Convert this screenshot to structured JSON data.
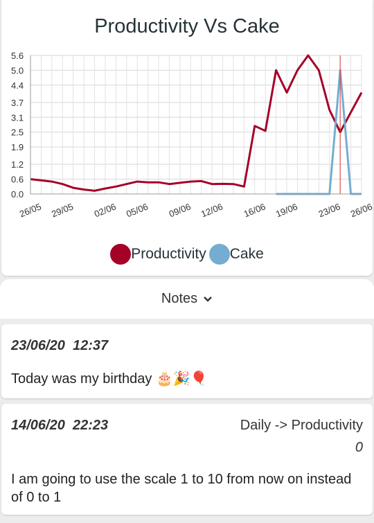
{
  "chart_data": {
    "type": "line",
    "title": "Productivity Vs Cake",
    "y_ticks": [
      "0.0",
      "0.6",
      "1.2",
      "1.9",
      "2.5",
      "3.1",
      "3.7",
      "4.4",
      "5.0",
      "5.6"
    ],
    "x_ticks": [
      "26/05",
      "29/05",
      "02/06",
      "05/06",
      "09/06",
      "12/06",
      "16/06",
      "19/06",
      "23/06",
      "26/06"
    ],
    "x_tick_days": [
      0,
      3,
      7,
      10,
      14,
      17,
      21,
      24,
      28,
      31
    ],
    "ylim": [
      0,
      5.6
    ],
    "x_range_days": [
      0,
      31
    ],
    "grid": true,
    "legend_position": "bottom",
    "marker_day": 29,
    "series": [
      {
        "name": "Productivity",
        "color": "#a50026",
        "points": [
          [
            0,
            0.6
          ],
          [
            1,
            0.55
          ],
          [
            2,
            0.5
          ],
          [
            3,
            0.4
          ],
          [
            4,
            0.25
          ],
          [
            5,
            0.18
          ],
          [
            6,
            0.13
          ],
          [
            7,
            0.22
          ],
          [
            8,
            0.3
          ],
          [
            9,
            0.4
          ],
          [
            10,
            0.5
          ],
          [
            11,
            0.47
          ],
          [
            12,
            0.47
          ],
          [
            13,
            0.4
          ],
          [
            14,
            0.45
          ],
          [
            15,
            0.5
          ],
          [
            16,
            0.52
          ],
          [
            17,
            0.4
          ],
          [
            18,
            0.41
          ],
          [
            19,
            0.4
          ],
          [
            20,
            0.3
          ],
          [
            21,
            2.75
          ],
          [
            22,
            2.55
          ],
          [
            23,
            5.0
          ],
          [
            24,
            4.1
          ],
          [
            25,
            5.0
          ],
          [
            26,
            5.6
          ],
          [
            27,
            5.0
          ],
          [
            28,
            3.4
          ],
          [
            29,
            2.5
          ],
          [
            30,
            3.3
          ],
          [
            31,
            4.1
          ]
        ]
      },
      {
        "name": "Cake",
        "color": "#74add1",
        "points": [
          [
            23,
            0
          ],
          [
            24,
            0
          ],
          [
            25,
            0
          ],
          [
            26,
            0
          ],
          [
            27,
            0
          ],
          [
            28,
            0
          ],
          [
            29,
            5.0
          ],
          [
            30,
            0
          ],
          [
            31,
            0
          ]
        ]
      }
    ]
  },
  "notes_header": {
    "label": "Notes"
  },
  "notes": [
    {
      "date": "23/06/20  12:37",
      "text": "Today was my birthday 🎂🎉🎈"
    },
    {
      "date": "14/06/20  22:23",
      "tracker": "Daily -> Productivity",
      "value": "0",
      "text": "I am going to use the scale 1 to 10 from now on instead of 0 to 1"
    }
  ]
}
